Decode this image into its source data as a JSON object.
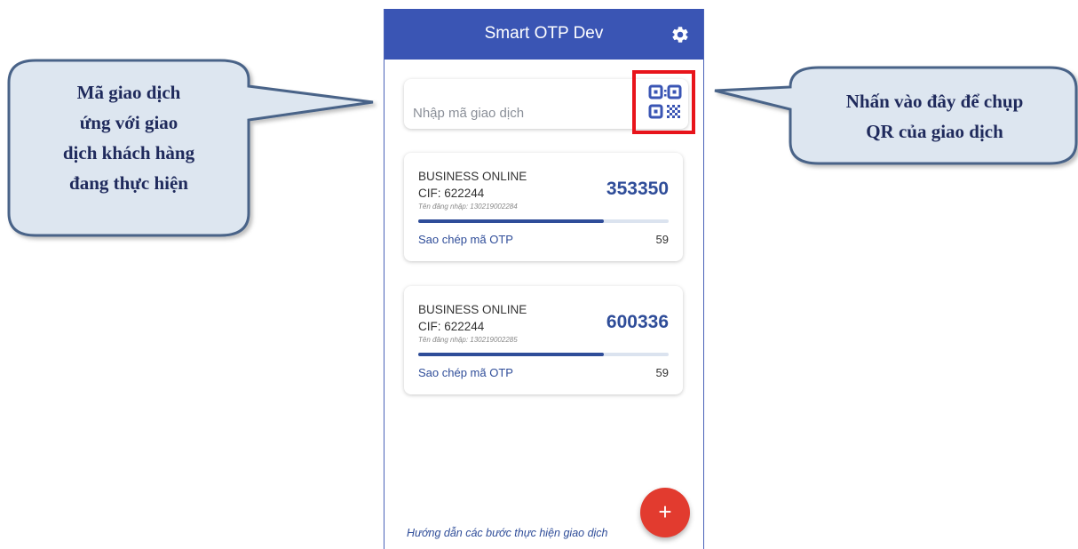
{
  "app": {
    "title": "Smart OTP Dev",
    "settings_icon": "gear-icon",
    "accent_color": "#3a55b4"
  },
  "search": {
    "placeholder": "Nhập mã giao dịch",
    "value": "",
    "scan_icon": "qr-code-icon",
    "highlight_color": "#e8141b"
  },
  "tokens": [
    {
      "service": "BUSINESS ONLINE",
      "cif": "CIF: 622244",
      "username": "Tên đăng nhập: 130219002284",
      "otp": "353350",
      "progress": 0.74,
      "copy_label": "Sao chép mã OTP",
      "countdown": "59"
    },
    {
      "service": "BUSINESS ONLINE",
      "cif": "CIF: 622244",
      "username": "Tên đăng nhập: 130219002285",
      "otp": "600336",
      "progress": 0.74,
      "copy_label": "Sao chép mã OTP",
      "countdown": "59"
    }
  ],
  "footer": {
    "guide_link": "Hướng dẫn các bước thực hiện giao dịch",
    "fab_label": "+",
    "fab_color": "#e23b2f"
  },
  "callouts": {
    "left": {
      "lines": [
        "Mã giao dịch",
        "ứng với giao",
        "dịch khách hàng",
        "đang thực hiện"
      ]
    },
    "right": {
      "lines": [
        "Nhấn vào đây để chụp",
        "QR của giao dịch"
      ]
    },
    "fill_color": "#dde6f0",
    "border_color": "#4a6488"
  }
}
